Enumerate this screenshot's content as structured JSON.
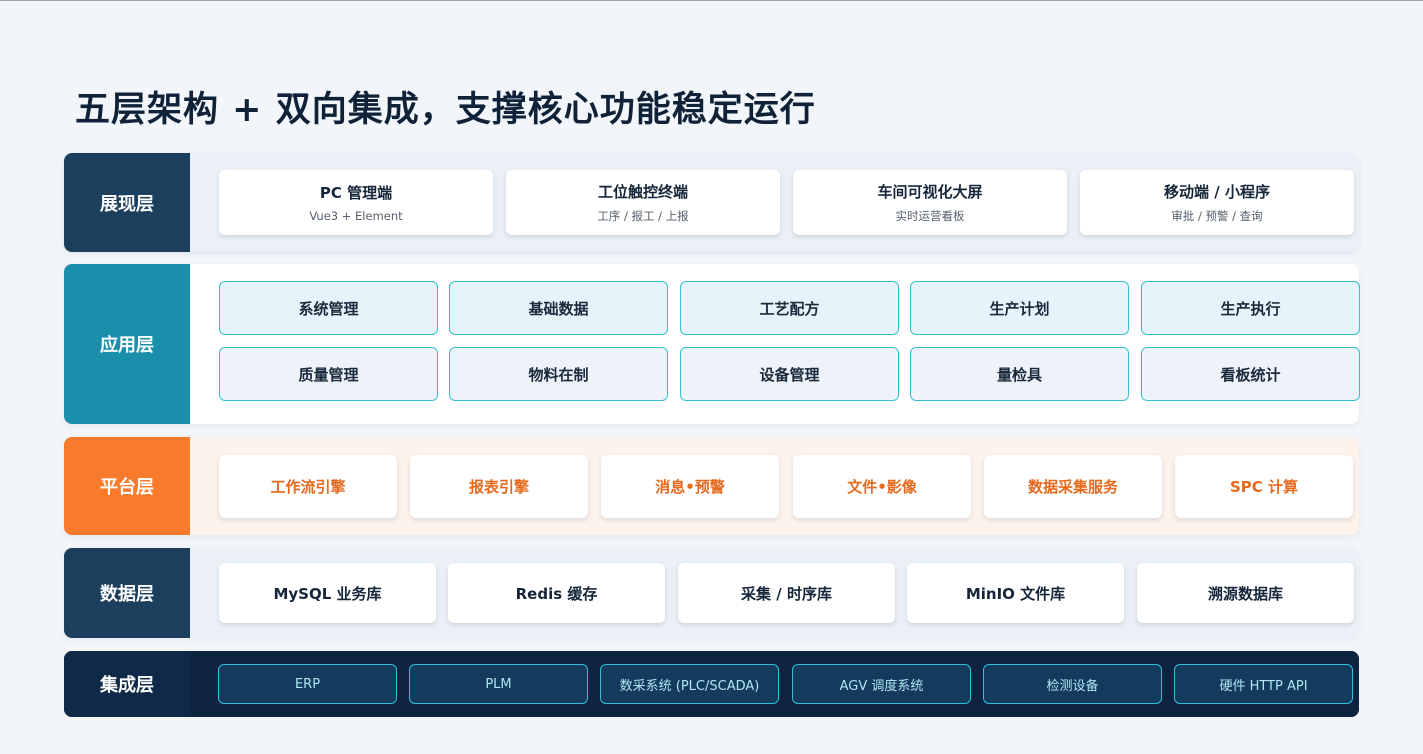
{
  "title": "五层架构 + 双向集成，支撑核心功能稳定运行",
  "layers": {
    "presentation": {
      "label": "展现层",
      "items": [
        {
          "name": "PC 管理端",
          "sub": "Vue3 + Element"
        },
        {
          "name": "工位触控终端",
          "sub": "工序 / 报工 / 上报"
        },
        {
          "name": "车间可视化大屏",
          "sub": "实时运营看板"
        },
        {
          "name": "移动端 / 小程序",
          "sub": "审批 / 预警 / 查询"
        }
      ]
    },
    "application": {
      "label": "应用层",
      "items": [
        "系统管理",
        "基础数据",
        "工艺配方",
        "生产计划",
        "生产执行",
        "质量管理",
        "物料在制",
        "设备管理",
        "量检具",
        "看板统计"
      ]
    },
    "platform": {
      "label": "平台层",
      "items": [
        "工作流引擎",
        "报表引擎",
        "消息•预警",
        "文件•影像",
        "数据采集服务",
        "SPC 计算"
      ]
    },
    "data": {
      "label": "数据层",
      "items": [
        "MySQL 业务库",
        "Redis 缓存",
        "采集 / 时序库",
        "MinIO 文件库",
        "溯源数据库"
      ]
    },
    "integration": {
      "label": "集成层",
      "items": [
        "ERP",
        "PLM",
        "数采系统 (PLC/SCADA)",
        "AGV 调度系统",
        "检测设备",
        "硬件 HTTP API"
      ]
    }
  },
  "colors": {
    "presentation": "#1d3f5e",
    "application": "#1a8fab",
    "platform": "#f77a2d",
    "data": "#1d3f5e",
    "integration": "#0f2a48",
    "accent_cyan": "#35c0d2",
    "accent_orange": "#e46a1e"
  }
}
